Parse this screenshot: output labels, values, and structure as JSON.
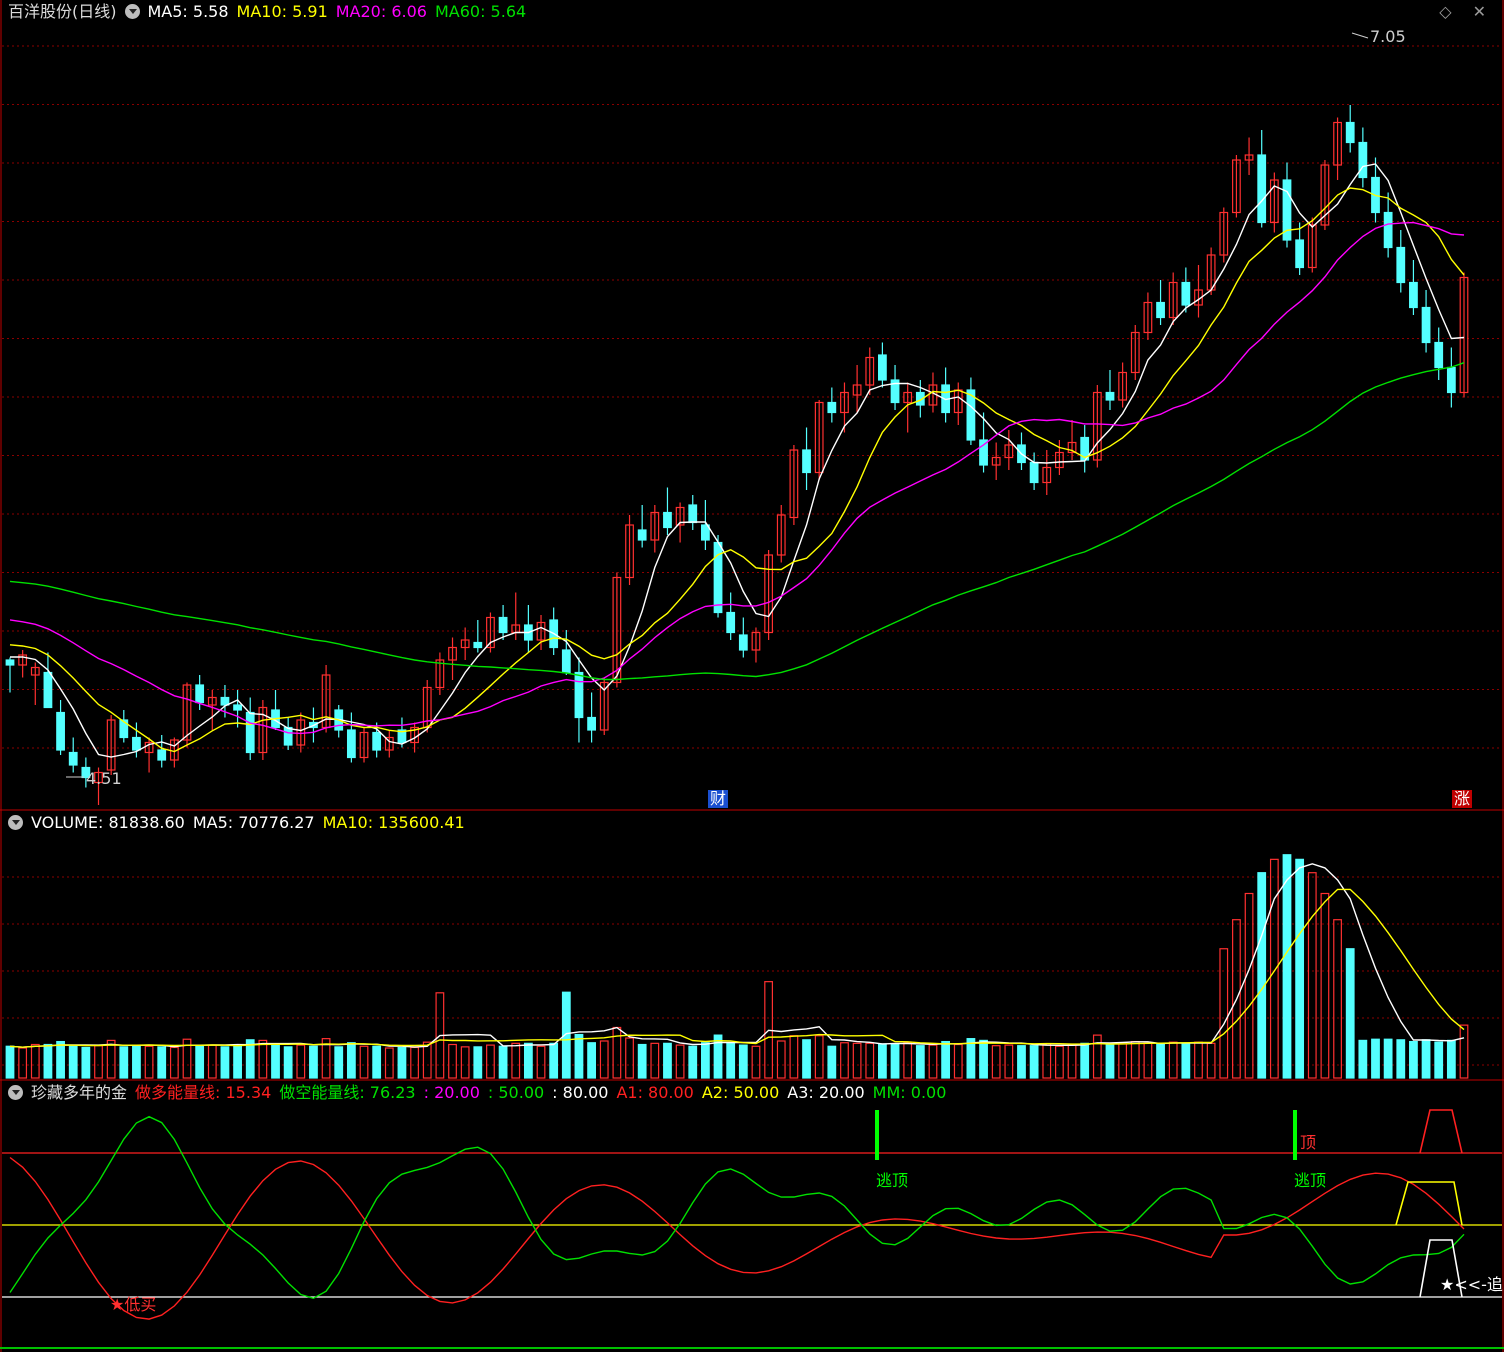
{
  "colors": {
    "bg": "#000000",
    "up": "#ff3030",
    "down": "#54ffff",
    "ma5": "#ffffff",
    "ma10": "#ffff00",
    "ma20": "#ff00ff",
    "ma60": "#00e000",
    "grid": "#8b0000",
    "panel_border": "#c00000"
  },
  "price_panel": {
    "title": "百洋股份(日线)",
    "indicators": [
      {
        "label": "MA5: 5.58",
        "color": "#ffffff"
      },
      {
        "label": "MA10: 5.91",
        "color": "#ffff00"
      },
      {
        "label": "MA20: 6.06",
        "color": "#ff00ff"
      },
      {
        "label": "MA60: 5.64",
        "color": "#00e000"
      }
    ],
    "high_label": "7.05",
    "low_label": "4.51",
    "marker_cai": "财",
    "marker_zhang": "涨",
    "top_icons": "◇ ✕"
  },
  "volume_panel": {
    "indicators": [
      {
        "label": "VOLUME: 81838.60",
        "color": "#ffffff"
      },
      {
        "label": "MA5: 70776.27",
        "color": "#ffffff"
      },
      {
        "label": "MA10: 135600.41",
        "color": "#ffff00"
      }
    ]
  },
  "indicator_panel": {
    "title": "珍藏多年的金",
    "indicators": [
      {
        "label": "做多能量线: 15.34",
        "color": "#ff2020"
      },
      {
        "label": "做空能量线: 76.23",
        "color": "#00e000"
      },
      {
        "label": ": 20.00",
        "color": "#ff00ff"
      },
      {
        "label": ": 50.00",
        "color": "#00e000"
      },
      {
        "label": ": 80.00",
        "color": "#ffffff"
      },
      {
        "label": "A1: 80.00",
        "color": "#ff2020"
      },
      {
        "label": "A2: 50.00",
        "color": "#ffff00"
      },
      {
        "label": "A3: 20.00",
        "color": "#ffffff"
      },
      {
        "label": "MM: 0.00",
        "color": "#00e000"
      }
    ],
    "signal_low_buy": "★低买",
    "signal_escape_top_1": "逃顶",
    "signal_escape_top_2": "逃顶",
    "signal_top": "顶",
    "signal_chase": "★<<-追"
  },
  "chart_data": {
    "type": "candlestick",
    "price_high": 7.05,
    "price_low": 4.51,
    "candles": [
      [
        4.83,
        4.84,
        4.7,
        4.81
      ],
      [
        4.81,
        4.87,
        4.76,
        4.85
      ],
      [
        4.77,
        4.82,
        4.65,
        4.8
      ],
      [
        4.78,
        4.86,
        4.69,
        4.64
      ],
      [
        4.62,
        4.67,
        4.45,
        4.47
      ],
      [
        4.46,
        4.52,
        4.38,
        4.41
      ],
      [
        4.4,
        4.44,
        4.32,
        4.36
      ],
      [
        4.34,
        4.4,
        4.25,
        4.38
      ],
      [
        4.39,
        4.61,
        4.37,
        4.59
      ],
      [
        4.59,
        4.63,
        4.5,
        4.52
      ],
      [
        4.52,
        4.58,
        4.44,
        4.47
      ],
      [
        4.46,
        4.52,
        4.38,
        4.5
      ],
      [
        4.47,
        4.53,
        4.4,
        4.43
      ],
      [
        4.43,
        4.52,
        4.4,
        4.51
      ],
      [
        4.51,
        4.74,
        4.48,
        4.73
      ],
      [
        4.73,
        4.77,
        4.63,
        4.66
      ],
      [
        4.65,
        4.71,
        4.55,
        4.68
      ],
      [
        4.68,
        4.73,
        4.6,
        4.65
      ],
      [
        4.65,
        4.71,
        4.56,
        4.63
      ],
      [
        4.62,
        4.68,
        4.43,
        4.46
      ],
      [
        4.46,
        4.67,
        4.43,
        4.64
      ],
      [
        4.63,
        4.71,
        4.55,
        4.56
      ],
      [
        4.56,
        4.6,
        4.47,
        4.49
      ],
      [
        4.49,
        4.62,
        4.46,
        4.59
      ],
      [
        4.58,
        4.64,
        4.5,
        4.56
      ],
      [
        4.56,
        4.81,
        4.54,
        4.77
      ],
      [
        4.63,
        4.65,
        4.52,
        4.55
      ],
      [
        4.55,
        4.62,
        4.42,
        4.44
      ],
      [
        4.44,
        4.56,
        4.42,
        4.54
      ],
      [
        4.54,
        4.58,
        4.44,
        4.47
      ],
      [
        4.47,
        4.55,
        4.44,
        4.52
      ],
      [
        4.55,
        4.6,
        4.48,
        4.5
      ],
      [
        4.5,
        4.58,
        4.46,
        4.56
      ],
      [
        4.56,
        4.75,
        4.54,
        4.72
      ],
      [
        4.72,
        4.86,
        4.69,
        4.83
      ],
      [
        4.83,
        4.92,
        4.75,
        4.88
      ],
      [
        4.88,
        4.96,
        4.83,
        4.91
      ],
      [
        4.9,
        4.99,
        4.86,
        4.88
      ],
      [
        4.88,
        5.02,
        4.86,
        5.0
      ],
      [
        5.0,
        5.05,
        4.91,
        4.94
      ],
      [
        4.94,
        5.1,
        4.91,
        4.97
      ],
      [
        4.97,
        5.05,
        4.86,
        4.91
      ],
      [
        4.91,
        5.01,
        4.87,
        4.98
      ],
      [
        4.99,
        5.04,
        4.85,
        4.88
      ],
      [
        4.87,
        4.95,
        4.77,
        4.78
      ],
      [
        4.78,
        4.84,
        4.5,
        4.6
      ],
      [
        4.6,
        4.7,
        4.5,
        4.55
      ],
      [
        4.55,
        4.76,
        4.53,
        4.74
      ],
      [
        4.74,
        5.18,
        4.72,
        5.16
      ],
      [
        5.16,
        5.41,
        5.13,
        5.37
      ],
      [
        5.35,
        5.45,
        5.28,
        5.31
      ],
      [
        5.31,
        5.45,
        5.26,
        5.42
      ],
      [
        5.42,
        5.52,
        5.33,
        5.36
      ],
      [
        5.37,
        5.46,
        5.3,
        5.44
      ],
      [
        5.45,
        5.49,
        5.35,
        5.38
      ],
      [
        5.37,
        5.47,
        5.27,
        5.31
      ],
      [
        5.3,
        5.33,
        5.0,
        5.02
      ],
      [
        5.02,
        5.1,
        4.91,
        4.94
      ],
      [
        4.93,
        5.0,
        4.84,
        4.87
      ],
      [
        4.87,
        4.96,
        4.82,
        4.94
      ],
      [
        4.94,
        5.27,
        4.91,
        5.25
      ],
      [
        5.25,
        5.45,
        5.22,
        5.41
      ],
      [
        5.4,
        5.69,
        5.37,
        5.67
      ],
      [
        5.67,
        5.76,
        5.51,
        5.58
      ],
      [
        5.58,
        5.87,
        5.55,
        5.86
      ],
      [
        5.86,
        5.92,
        5.78,
        5.82
      ],
      [
        5.82,
        5.94,
        5.74,
        5.9
      ],
      [
        5.89,
        6.01,
        5.82,
        5.93
      ],
      [
        5.93,
        6.08,
        5.89,
        6.04
      ],
      [
        6.05,
        6.1,
        5.92,
        5.95
      ],
      [
        5.95,
        6.01,
        5.83,
        5.86
      ],
      [
        5.86,
        5.94,
        5.74,
        5.9
      ],
      [
        5.9,
        5.95,
        5.8,
        5.85
      ],
      [
        5.85,
        5.98,
        5.82,
        5.93
      ],
      [
        5.93,
        6.0,
        5.78,
        5.82
      ],
      [
        5.82,
        5.94,
        5.77,
        5.91
      ],
      [
        5.91,
        5.96,
        5.69,
        5.71
      ],
      [
        5.71,
        5.82,
        5.58,
        5.61
      ],
      [
        5.61,
        5.7,
        5.55,
        5.64
      ],
      [
        5.64,
        5.75,
        5.59,
        5.69
      ],
      [
        5.69,
        5.74,
        5.59,
        5.62
      ],
      [
        5.62,
        5.66,
        5.51,
        5.54
      ],
      [
        5.54,
        5.67,
        5.49,
        5.6
      ],
      [
        5.6,
        5.71,
        5.57,
        5.66
      ],
      [
        5.66,
        5.79,
        5.63,
        5.7
      ],
      [
        5.72,
        5.77,
        5.58,
        5.63
      ],
      [
        5.63,
        5.93,
        5.6,
        5.9
      ],
      [
        5.9,
        5.99,
        5.83,
        5.87
      ],
      [
        5.87,
        6.02,
        5.84,
        5.98
      ],
      [
        5.98,
        6.17,
        5.95,
        6.14
      ],
      [
        6.14,
        6.3,
        6.11,
        6.26
      ],
      [
        6.26,
        6.35,
        6.17,
        6.2
      ],
      [
        6.2,
        6.38,
        6.17,
        6.34
      ],
      [
        6.34,
        6.4,
        6.22,
        6.25
      ],
      [
        6.25,
        6.41,
        6.2,
        6.31
      ],
      [
        6.31,
        6.48,
        6.29,
        6.45
      ],
      [
        6.45,
        6.64,
        6.42,
        6.62
      ],
      [
        6.62,
        6.85,
        6.6,
        6.83
      ],
      [
        6.83,
        6.92,
        6.77,
        6.85
      ],
      [
        6.85,
        6.95,
        6.56,
        6.58
      ],
      [
        6.58,
        6.78,
        6.54,
        6.75
      ],
      [
        6.75,
        6.82,
        6.48,
        6.51
      ],
      [
        6.51,
        6.58,
        6.37,
        6.4
      ],
      [
        6.4,
        6.6,
        6.38,
        6.57
      ],
      [
        6.57,
        6.83,
        6.55,
        6.81
      ],
      [
        6.81,
        7.0,
        6.75,
        6.98
      ],
      [
        6.98,
        7.05,
        6.86,
        6.9
      ],
      [
        6.9,
        6.96,
        6.72,
        6.76
      ],
      [
        6.76,
        6.84,
        6.58,
        6.62
      ],
      [
        6.62,
        6.7,
        6.44,
        6.48
      ],
      [
        6.48,
        6.55,
        6.3,
        6.34
      ],
      [
        6.34,
        6.43,
        6.21,
        6.24
      ],
      [
        6.24,
        6.31,
        6.06,
        6.1
      ],
      [
        6.1,
        6.16,
        5.95,
        6.0
      ],
      [
        6.0,
        6.08,
        5.84,
        5.9
      ],
      [
        5.9,
        6.38,
        5.88,
        6.36
      ]
    ]
  }
}
